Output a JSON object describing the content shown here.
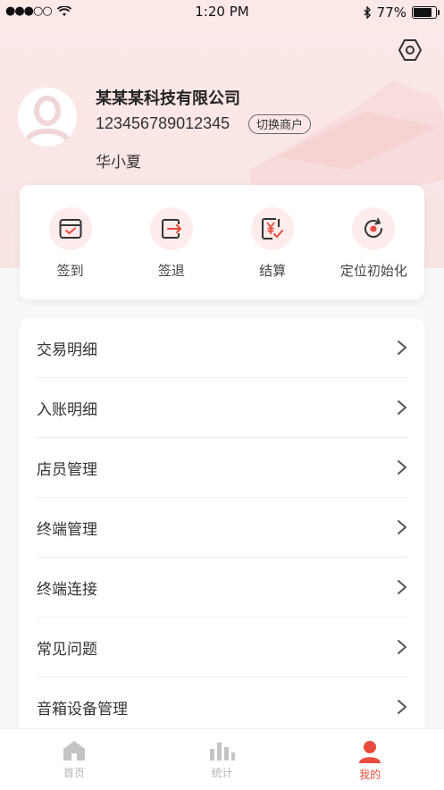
{
  "status_bar": {
    "time": "1:20 PM",
    "battery": "77%",
    "battery_level": 0.77
  },
  "profile": {
    "merchant_name": "某某某科技有限公司",
    "merchant_id": "123456789012345",
    "switch_label": "切换商户",
    "user_name": "华小夏"
  },
  "actions": [
    {
      "label": "签到",
      "icon": "calendar-check-icon"
    },
    {
      "label": "签退",
      "icon": "sign-out-icon"
    },
    {
      "label": "结算",
      "icon": "yen-document-icon"
    },
    {
      "label": "定位初始化",
      "icon": "refresh-location-icon"
    }
  ],
  "menu": [
    {
      "label": "交易明细"
    },
    {
      "label": "入账明细"
    },
    {
      "label": "店员管理"
    },
    {
      "label": "终端管理"
    },
    {
      "label": "终端连接"
    },
    {
      "label": "常见问题"
    },
    {
      "label": "音箱设备管理"
    }
  ],
  "tabbar": [
    {
      "label": "首页",
      "icon": "home-icon"
    },
    {
      "label": "统计",
      "icon": "bar-chart-icon"
    },
    {
      "label": "我的",
      "icon": "user-icon"
    }
  ],
  "colors": {
    "accent": "#e94b3c",
    "hero_bg": "#fde8e8",
    "inactive": "#b5b5b5"
  }
}
